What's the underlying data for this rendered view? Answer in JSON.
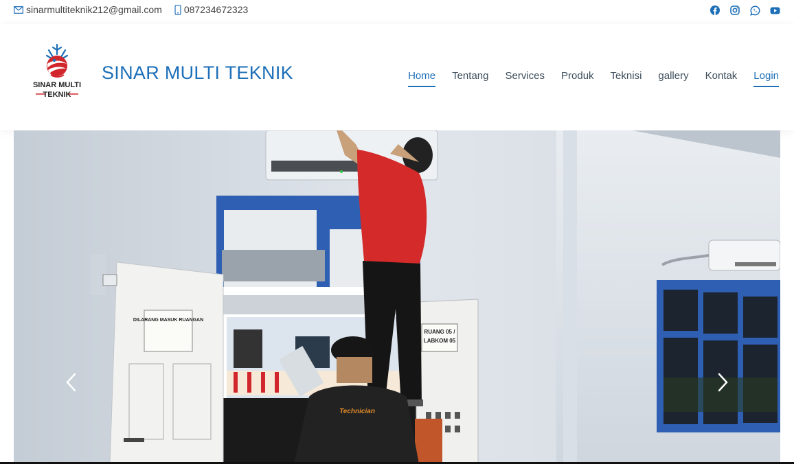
{
  "topbar": {
    "email": "sinarmultiteknik212@gmail.com",
    "phone": "087234672323",
    "email_icon": "envelope-icon",
    "phone_icon": "mobile-phone-icon",
    "social": [
      "facebook-icon",
      "instagram-icon",
      "whatsapp-icon",
      "youtube-icon"
    ]
  },
  "header": {
    "logo_line1": "SINAR MULTI",
    "logo_line2": "TEKNIK",
    "brand": "SINAR MULTI TEKNIK"
  },
  "nav": {
    "items": [
      {
        "label": "Home",
        "active": true
      },
      {
        "label": "Tentang"
      },
      {
        "label": "Services"
      },
      {
        "label": "Produk"
      },
      {
        "label": "Teknisi"
      },
      {
        "label": "gallery"
      },
      {
        "label": "Kontak"
      },
      {
        "label": "Login",
        "highlight": true
      }
    ]
  },
  "hero": {
    "sign_door": "DILARANG MASUK RUANGAN",
    "sign_room_1": "RUANG 05 /",
    "sign_room_2": "LABKOM 05",
    "shirt_text": "Technician"
  },
  "colors": {
    "brand_blue": "#1d6fb8",
    "nav_text": "#3d4e5c",
    "logo_red": "#d1262c"
  }
}
